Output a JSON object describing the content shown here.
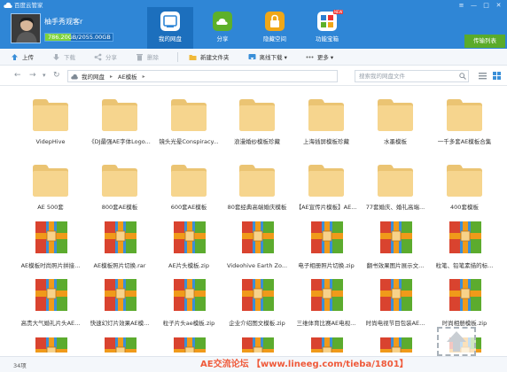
{
  "app": {
    "title": "百度云管家"
  },
  "window_controls": [
    "≡",
    "—",
    "□",
    "✕"
  ],
  "user": {
    "name": "柚手秀观客r",
    "quota_text": "786.20GB/2055.00GB",
    "quota_used_fraction": 0.383
  },
  "nav": [
    {
      "label": "我的网盘",
      "icon": "cloud-drive-icon",
      "active": true,
      "color": "#1c6fbd"
    },
    {
      "label": "分享",
      "icon": "share-icon",
      "active": false,
      "color": "#5db02a"
    },
    {
      "label": "隐藏空间",
      "icon": "lock-icon",
      "active": false,
      "color": "#f0a718"
    },
    {
      "label": "功能宝箱",
      "icon": "toolbox-icon",
      "active": false,
      "color": "#2d7fd1",
      "badge": "NEW"
    }
  ],
  "transfer_button": "传输列表",
  "toolbar": [
    {
      "label": "上传",
      "icon": "upload-icon",
      "disabled": false
    },
    {
      "label": "下载",
      "icon": "download-icon",
      "disabled": true
    },
    {
      "label": "分享",
      "icon": "share-icon",
      "disabled": true
    },
    {
      "label": "删除",
      "icon": "delete-icon",
      "disabled": true
    },
    {
      "label": "新建文件夹",
      "icon": "new-folder-icon",
      "disabled": false
    },
    {
      "label": "离线下载 ▾",
      "icon": "offline-download-icon",
      "disabled": false
    },
    {
      "label": "更多 ▾",
      "icon": "more-icon",
      "disabled": false
    }
  ],
  "breadcrumb": [
    "我的网盘",
    "AE模板"
  ],
  "search": {
    "placeholder": "搜索我的网盘文件"
  },
  "files": [
    {
      "name": "VidepHive",
      "type": "folder"
    },
    {
      "name": "《DJ最强AE字体Logo...",
      "type": "folder"
    },
    {
      "name": "镜头光晕Conspiracy...",
      "type": "folder"
    },
    {
      "name": "浪漫婚纱模板珍藏",
      "type": "folder"
    },
    {
      "name": "上海插屏模板珍藏",
      "type": "folder"
    },
    {
      "name": "水墨模板",
      "type": "folder"
    },
    {
      "name": "一千多套AE模板合集",
      "type": "folder"
    },
    {
      "name": "AE 500套",
      "type": "folder"
    },
    {
      "name": "800套AE模板",
      "type": "folder"
    },
    {
      "name": "600套AE模板",
      "type": "folder"
    },
    {
      "name": "80套经典高端婚庆模板",
      "type": "folder"
    },
    {
      "name": "【AE宣传片模板】AE...",
      "type": "folder"
    },
    {
      "name": "77套婚庆、婚礼高端...",
      "type": "folder"
    },
    {
      "name": "400套模板",
      "type": "folder"
    },
    {
      "name": "AE模板时尚照片拼接...",
      "type": "archive"
    },
    {
      "name": "AE模板照片切换.rar",
      "type": "archive"
    },
    {
      "name": "AE片头模板.zip",
      "type": "archive"
    },
    {
      "name": "Videohive Earth Zo...",
      "type": "archive"
    },
    {
      "name": "电子相册照片切换.zip",
      "type": "archive"
    },
    {
      "name": "翻书效果图片展示文...",
      "type": "archive"
    },
    {
      "name": "粒笔、铅笔素描的标...",
      "type": "archive"
    },
    {
      "name": "高贵大气婚礼片头AE...",
      "type": "archive"
    },
    {
      "name": "快速幻灯片效果AE模...",
      "type": "archive"
    },
    {
      "name": "粒子片头ae模板.zip",
      "type": "archive"
    },
    {
      "name": "企业介绍图文模板.zip",
      "type": "archive"
    },
    {
      "name": "三维体育比赛AE电视...",
      "type": "archive"
    },
    {
      "name": "时尚电视节目包装AE...",
      "type": "archive"
    },
    {
      "name": "时尚相册模板.zip",
      "type": "archive"
    },
    {
      "name": "",
      "type": "archive"
    },
    {
      "name": "",
      "type": "archive"
    },
    {
      "name": "",
      "type": "archive"
    },
    {
      "name": "",
      "type": "archive"
    },
    {
      "name": "",
      "type": "archive"
    },
    {
      "name": "",
      "type": "archive"
    },
    {
      "name": "",
      "type": "archive"
    }
  ],
  "status": {
    "count": "34项"
  },
  "watermark": "AE交流论坛 【www.lineeg.com/tieba/1801】",
  "colors": {
    "header": "#2f86d6",
    "folder": "#f6d58e",
    "folder_dark": "#ebc473",
    "archive_red": "#d9432f",
    "archive_blue": "#3a8fd8",
    "archive_green": "#5cab2e",
    "archive_orange": "#f09a1a"
  }
}
